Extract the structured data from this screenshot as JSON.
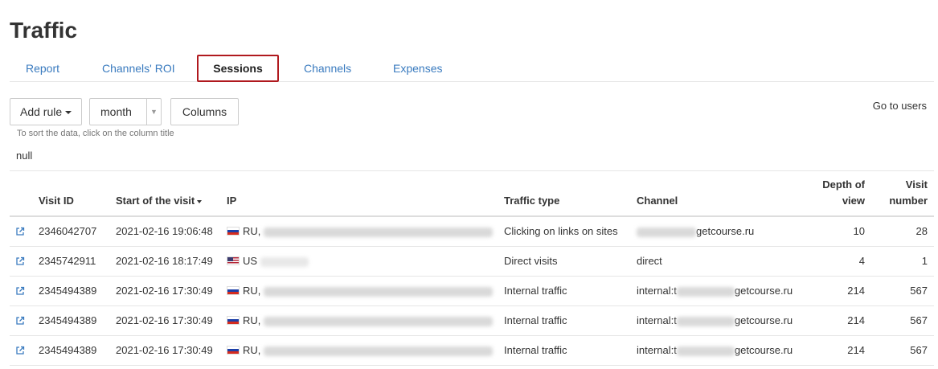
{
  "page": {
    "title": "Traffic"
  },
  "tabs": [
    {
      "label": "Report"
    },
    {
      "label": "Channels' ROI"
    },
    {
      "label": "Sessions"
    },
    {
      "label": "Channels"
    },
    {
      "label": "Expenses"
    }
  ],
  "active_tab": "Sessions",
  "toolbar": {
    "add_rule_label": "Add rule",
    "period_select_value": "month",
    "columns_label": "Columns",
    "goto_users_label": "Go to users"
  },
  "hint_text": "To sort the data, click on the column title",
  "null_text": "null",
  "table": {
    "headers": {
      "visit_id": "Visit ID",
      "start": "Start of the visit",
      "ip": "IP",
      "traffic_type": "Traffic type",
      "channel": "Channel",
      "depth_line1": "Depth of",
      "depth_line2": "view",
      "visit_line1": "Visit",
      "visit_line2": "number"
    },
    "rows": [
      {
        "visit_id": "2346042707",
        "start": "2021-02-16 19:06:48",
        "country": "RU,",
        "flag": "ru-flag-icon",
        "traffic_type": "Clicking on links on sites",
        "channel_prefix": "",
        "channel_suffix": "getcourse.ru",
        "depth": "10",
        "visit_number": "28"
      },
      {
        "visit_id": "2345742911",
        "start": "2021-02-16 18:17:49",
        "country": "US",
        "flag": "us-flag-icon",
        "traffic_type": "Direct visits",
        "channel_prefix": "direct",
        "channel_suffix": "",
        "depth": "4",
        "visit_number": "1"
      },
      {
        "visit_id": "2345494389",
        "start": "2021-02-16 17:30:49",
        "country": "RU,",
        "flag": "ru-flag-icon",
        "traffic_type": "Internal traffic",
        "channel_prefix": "internal:t",
        "channel_suffix": "getcourse.ru",
        "depth": "214",
        "visit_number": "567"
      },
      {
        "visit_id": "2345494389",
        "start": "2021-02-16 17:30:49",
        "country": "RU,",
        "flag": "ru-flag-icon",
        "traffic_type": "Internal traffic",
        "channel_prefix": "internal:t",
        "channel_suffix": "getcourse.ru",
        "depth": "214",
        "visit_number": "567"
      },
      {
        "visit_id": "2345494389",
        "start": "2021-02-16 17:30:49",
        "country": "RU,",
        "flag": "ru-flag-icon",
        "traffic_type": "Internal traffic",
        "channel_prefix": "internal:t",
        "channel_suffix": "getcourse.ru",
        "depth": "214",
        "visit_number": "567"
      }
    ]
  },
  "colors": {
    "link": "#3a7bbf",
    "active_tab_border": "#b0191e",
    "text": "#333333"
  }
}
